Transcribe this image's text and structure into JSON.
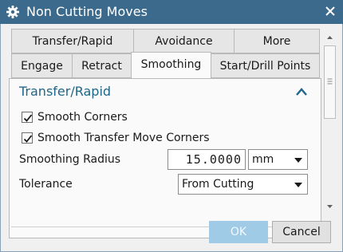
{
  "window": {
    "title": "Non Cutting Moves",
    "icon": "gear-icon",
    "close_icon": "close-icon"
  },
  "tabs": {
    "row1": [
      "Transfer/Rapid",
      "Avoidance",
      "More"
    ],
    "row2": [
      "Engage",
      "Retract",
      "Smoothing",
      "Start/Drill Points"
    ],
    "active": "Smoothing"
  },
  "section": {
    "title": "Transfer/Rapid",
    "collapse_icon": "chevron-up-icon",
    "accent": "#1f6688"
  },
  "options": {
    "smooth_corners": {
      "label": "Smooth Corners",
      "checked": true
    },
    "smooth_transfer": {
      "label": "Smooth Transfer Move Corners",
      "checked": true
    }
  },
  "fields": {
    "smoothing_radius": {
      "label": "Smoothing Radius",
      "value": "15.0000",
      "unit": "mm"
    },
    "tolerance": {
      "label": "Tolerance",
      "value": "From Cutting"
    }
  },
  "buttons": {
    "ok": "OK",
    "cancel": "Cancel"
  },
  "colors": {
    "titlebar": "#3c6a8c",
    "ok_button": "#9fcbe6"
  }
}
